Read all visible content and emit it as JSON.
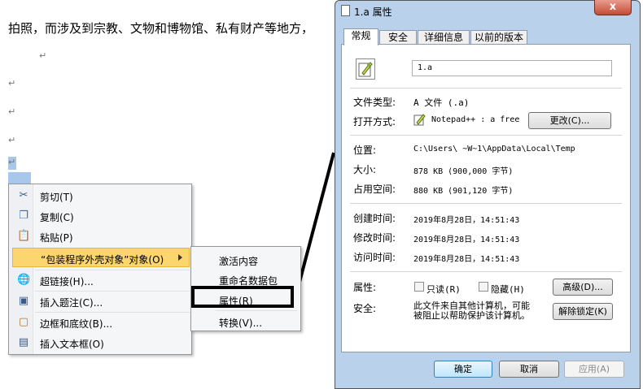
{
  "document": {
    "text_line": "拍照，而涉及到宗教、文物和博物馆、私有财产等地方，",
    "para_mark": "↵"
  },
  "context_menu": {
    "items": [
      {
        "label": "剪切(T)",
        "icon": "scissors-icon"
      },
      {
        "label": "复制(C)",
        "icon": "copy-icon"
      },
      {
        "label": "粘贴(P)",
        "icon": "paste-icon"
      },
      {
        "label": "“包装程序外壳对象”对象(O)",
        "icon": ""
      },
      {
        "label": "超链接(H)...",
        "icon": "hyperlink-icon"
      },
      {
        "label": "插入题注(C)...",
        "icon": "caption-icon"
      },
      {
        "label": "边框和底纹(B)...",
        "icon": "border-icon"
      },
      {
        "label": "插入文本框(O)",
        "icon": "textbox-icon"
      }
    ],
    "submenu": [
      {
        "label": "激活内容"
      },
      {
        "label": "重命名数据包"
      },
      {
        "label": "属性(R)"
      },
      {
        "label": "转换(V)..."
      }
    ]
  },
  "dialog": {
    "title": "1.a 属性",
    "close_label": "x",
    "tabs": [
      "常规",
      "安全",
      "详细信息",
      "以前的版本"
    ],
    "file_name": "1.a",
    "file_type_label": "文件类型:",
    "file_type_value": "A 文件 (.a)",
    "open_with_label": "打开方式:",
    "open_with_value": "Notepad++ : a free",
    "change_button": "更改(C)...",
    "location_label": "位置:",
    "location_value": "C:\\Users\\   ~W~1\\AppData\\Local\\Temp",
    "size_label": "大小:",
    "size_value": "878 KB (900,000 字节)",
    "size_on_disk_label": "占用空间:",
    "size_on_disk_value": "880 KB (901,120 字节)",
    "created_label": "创建时间:",
    "created_value": "2019年8月28日，14:51:43",
    "modified_label": "修改时间:",
    "modified_value": "2019年8月28日，14:51:43",
    "accessed_label": "访问时间:",
    "accessed_value": "2019年8月28日，14:51:43",
    "attributes_label": "属性:",
    "readonly_label": "只读(R)",
    "hidden_label": "隐藏(H)",
    "advanced_button": "高级(D)...",
    "security_label": "安全:",
    "security_text_1": "此文件来自其他计算机，可能",
    "security_text_2": "被阻止以帮助保护该计算机。",
    "unblock_button": "解除锁定(K)",
    "ok_button": "确定",
    "cancel_button": "取消",
    "apply_button": "应用(A)"
  }
}
